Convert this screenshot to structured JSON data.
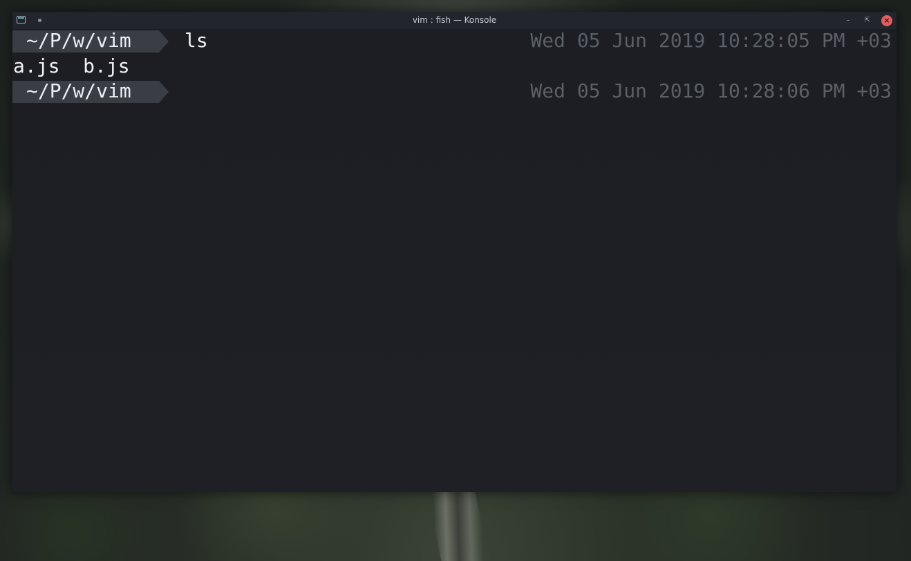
{
  "window": {
    "title": "vim : fish — Konsole",
    "icons": [
      "terminal-app-icon",
      "pin-icon",
      "minimize-icon",
      "maximize-icon",
      "close-icon"
    ],
    "colors": {
      "terminal_bg": "#1c1e24",
      "prompt_bg": "#3a3d44",
      "timestamp": "#5b5f66",
      "close_button": "#e65c5c"
    }
  },
  "terminal": {
    "lines": [
      {
        "type": "prompt",
        "cwd": "~/P/w/vim",
        "command": "ls",
        "time": "Wed 05 Jun 2019 10:28:05 PM +03"
      },
      {
        "type": "output",
        "text": "a.js  b.js"
      },
      {
        "type": "prompt",
        "cwd": "~/P/w/vim",
        "command": "",
        "time": "Wed 05 Jun 2019 10:28:06 PM +03"
      }
    ]
  }
}
